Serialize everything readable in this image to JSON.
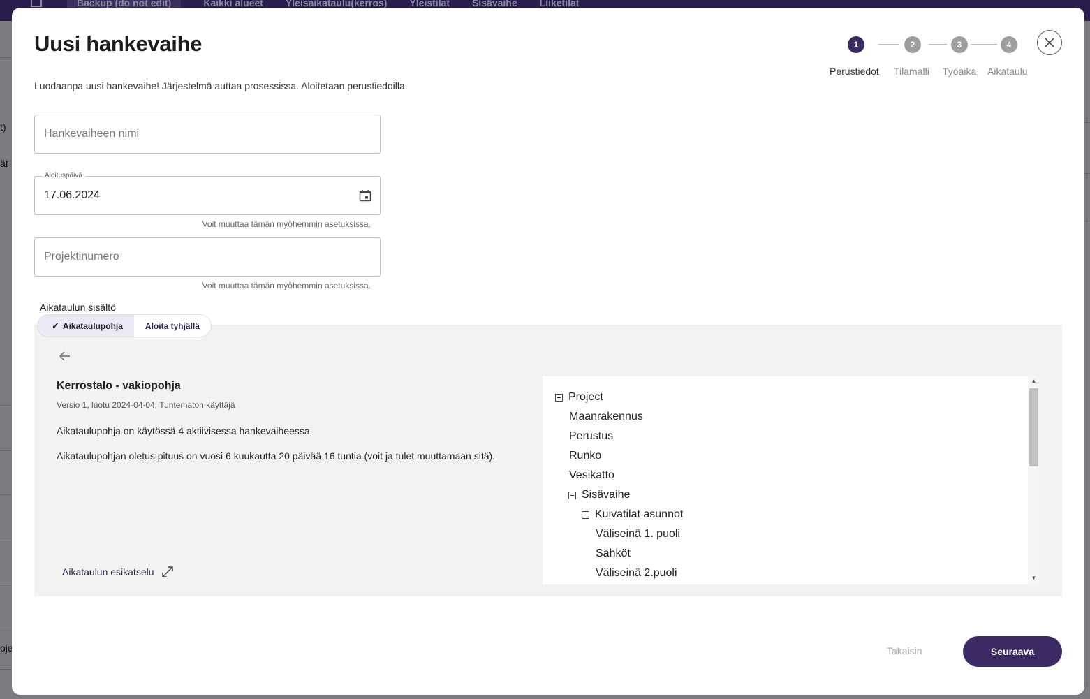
{
  "background": {
    "breadcrumb": "Backup (do not edit)",
    "nav": [
      "Kaikki alueet",
      "Yleisaikataulu(kerros)",
      "Yleistilat",
      "Sisävaihe",
      "Liiketilat"
    ],
    "left_fragments": [
      "t)",
      "ät",
      "oje"
    ]
  },
  "modal": {
    "title": "Uusi hankevaihe",
    "subtitle": "Luodaanpa uusi hankevaihe! Järjestelmä auttaa prosessissa. Aloitetaan perustiedoilla."
  },
  "stepper": {
    "steps": [
      {
        "number": "1",
        "label": "Perustiedot",
        "active": true
      },
      {
        "number": "2",
        "label": "Tilamalli",
        "active": false
      },
      {
        "number": "3",
        "label": "Työaika",
        "active": false
      },
      {
        "number": "4",
        "label": "Aikataulu",
        "active": false
      }
    ]
  },
  "form": {
    "name": {
      "placeholder": "Hankevaiheen nimi",
      "value": ""
    },
    "start_date": {
      "label": "Aloituspäivä",
      "value": "17.06.2024",
      "helper": "Voit muuttaa tämän myöhemmin asetuksissa."
    },
    "project_number": {
      "placeholder": "Projektinumero",
      "value": "",
      "helper": "Voit muuttaa tämän myöhemmin asetuksissa."
    }
  },
  "schedule_content": {
    "label": "Aikataulun sisältö",
    "options": [
      {
        "label": "Aikataulupohja",
        "selected": true
      },
      {
        "label": "Aloita tyhjällä",
        "selected": false
      }
    ]
  },
  "template": {
    "title": "Kerrostalo - vakiopohja",
    "meta": "Versio 1, luotu 2024-04-04, Tuntematon käyttäjä",
    "usage": "Aikataulupohja on käytössä 4 aktiivisessa hankevaiheessa.",
    "length": "Aikataulupohjan oletus pituus on vuosi 6 kuukautta 20 päivää 16 tuntia (voit ja tulet muuttamaan sitä).",
    "preview_link": "Aikataulun esikatselu"
  },
  "tree": [
    {
      "label": "Project",
      "level": 0,
      "collapsible": true
    },
    {
      "label": "Maanrakennus",
      "level": 1,
      "collapsible": false
    },
    {
      "label": "Perustus",
      "level": 1,
      "collapsible": false
    },
    {
      "label": "Runko",
      "level": 1,
      "collapsible": false
    },
    {
      "label": "Vesikatto",
      "level": 1,
      "collapsible": false
    },
    {
      "label": "Sisävaihe",
      "level": 1,
      "collapsible": true
    },
    {
      "label": "Kuivatilat asunnot",
      "level": 2,
      "collapsible": true
    },
    {
      "label": "Väliseinä 1. puoli",
      "level": 3,
      "collapsible": false
    },
    {
      "label": "Sähköt",
      "level": 3,
      "collapsible": false
    },
    {
      "label": "Väliseinä 2.puoli",
      "level": 3,
      "collapsible": false
    }
  ],
  "footer": {
    "back_label": "Takaisin",
    "next_label": "Seuraava"
  },
  "colors": {
    "primary": "#3b2a63",
    "panel": "#f2f2f0",
    "topbar": "#2a1e4e"
  }
}
